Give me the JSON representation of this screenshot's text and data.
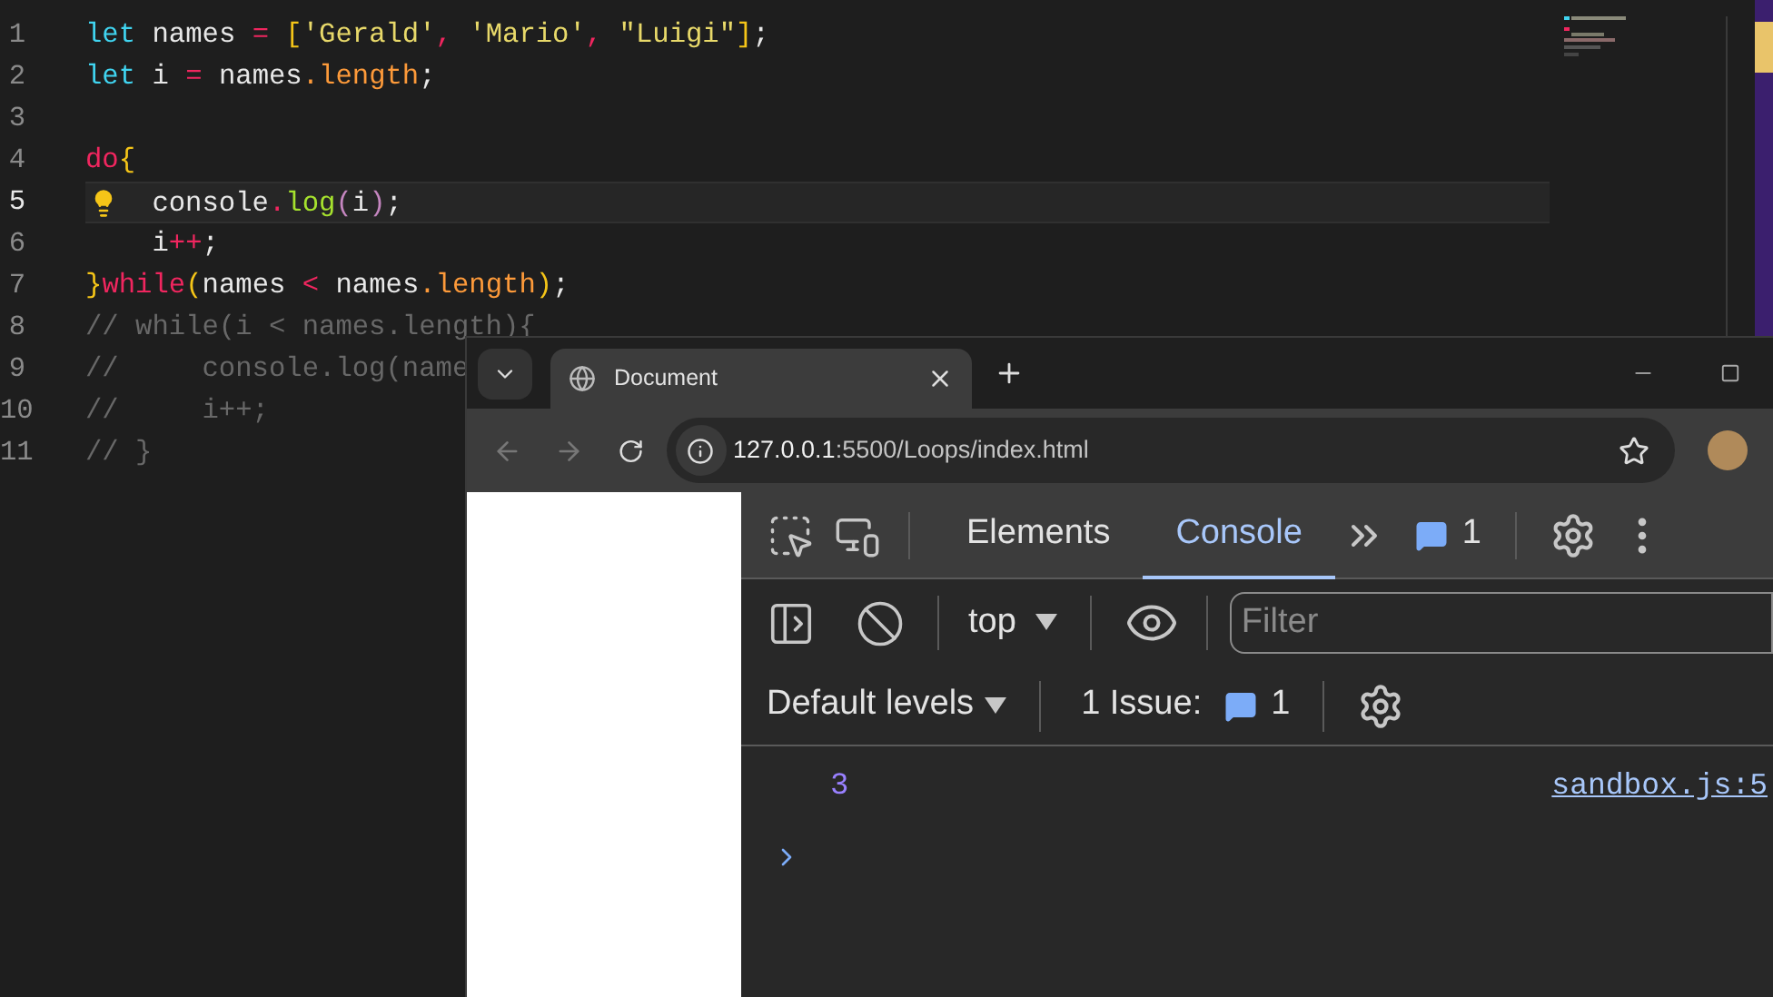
{
  "editor": {
    "lines": [
      {
        "number": "1",
        "current": false,
        "tokens": [
          {
            "kind": "kw",
            "text": "let"
          },
          {
            "kind": "plain",
            "text": " names "
          },
          {
            "kind": "op",
            "text": "="
          },
          {
            "kind": "bracket",
            "text": " ["
          },
          {
            "kind": "string",
            "text": "'Gerald'"
          },
          {
            "kind": "op",
            "text": ","
          },
          {
            "kind": "string",
            "text": " 'Mario'"
          },
          {
            "kind": "op",
            "text": ","
          },
          {
            "kind": "string",
            "text": " \"Luigi\""
          },
          {
            "kind": "bracket",
            "text": "]"
          },
          {
            "kind": "plain",
            "text": ";"
          }
        ]
      },
      {
        "number": "2",
        "current": false,
        "tokens": [
          {
            "kind": "kw",
            "text": "let"
          },
          {
            "kind": "plain",
            "text": " i "
          },
          {
            "kind": "op",
            "text": "="
          },
          {
            "kind": "plain",
            "text": " names"
          },
          {
            "kind": "prop",
            "text": ".length"
          },
          {
            "kind": "plain",
            "text": ";"
          }
        ]
      },
      {
        "number": "3",
        "current": false
      },
      {
        "number": "4",
        "current": false,
        "tokens": [
          {
            "kind": "ctrl",
            "text": "do"
          },
          {
            "kind": "bracket",
            "text": "{"
          }
        ]
      },
      {
        "number": "5",
        "current": true,
        "indented": true,
        "tokens": [
          {
            "kind": "plain",
            "text": "console"
          },
          {
            "kind": "op",
            "text": "."
          },
          {
            "kind": "method",
            "text": "log"
          },
          {
            "kind": "paren",
            "text": "("
          },
          {
            "kind": "plain",
            "text": "i"
          },
          {
            "kind": "paren",
            "text": ")"
          },
          {
            "kind": "plain",
            "text": ";"
          }
        ]
      },
      {
        "number": "6",
        "current": false,
        "indented": true,
        "tokens": [
          {
            "kind": "plain",
            "text": "i"
          },
          {
            "kind": "op",
            "text": "++"
          },
          {
            "kind": "plain",
            "text": ";"
          }
        ]
      },
      {
        "number": "7",
        "current": false,
        "tokens": [
          {
            "kind": "bracket",
            "text": "}"
          },
          {
            "kind": "ctrl",
            "text": "while"
          },
          {
            "kind": "bracket",
            "text": "("
          },
          {
            "kind": "plain",
            "text": "names "
          },
          {
            "kind": "op",
            "text": "<"
          },
          {
            "kind": "plain",
            "text": " names"
          },
          {
            "kind": "prop",
            "text": ".length"
          },
          {
            "kind": "bracket",
            "text": ")"
          },
          {
            "kind": "plain",
            "text": ";"
          }
        ]
      },
      {
        "number": "8",
        "current": false,
        "tokens": [
          {
            "kind": "comment",
            "text": "// while(i < names.length){"
          }
        ]
      },
      {
        "number": "9",
        "current": false,
        "tokens": [
          {
            "kind": "comment",
            "text": "//     console.log(name"
          }
        ]
      },
      {
        "number": "10",
        "current": false,
        "tokens": [
          {
            "kind": "comment",
            "text": "//     i++;"
          }
        ]
      },
      {
        "number": "11",
        "current": false,
        "tokens": [
          {
            "kind": "comment",
            "text": "// }"
          }
        ]
      }
    ]
  },
  "browser": {
    "tab_title": "Document",
    "url_host": "127.0.0.1",
    "url_path": ":5500/Loops/index.html"
  },
  "devtools": {
    "tabs": [
      {
        "label": "Elements",
        "selected": false
      },
      {
        "label": "Console",
        "selected": true
      }
    ],
    "issues_badge": "1",
    "context": "top",
    "filter_placeholder": "Filter",
    "levels": "Default levels",
    "issue_label": "1 Issue:",
    "issue_count": "1",
    "log": [
      {
        "value": "3",
        "source": "sandbox.js:5"
      }
    ]
  }
}
